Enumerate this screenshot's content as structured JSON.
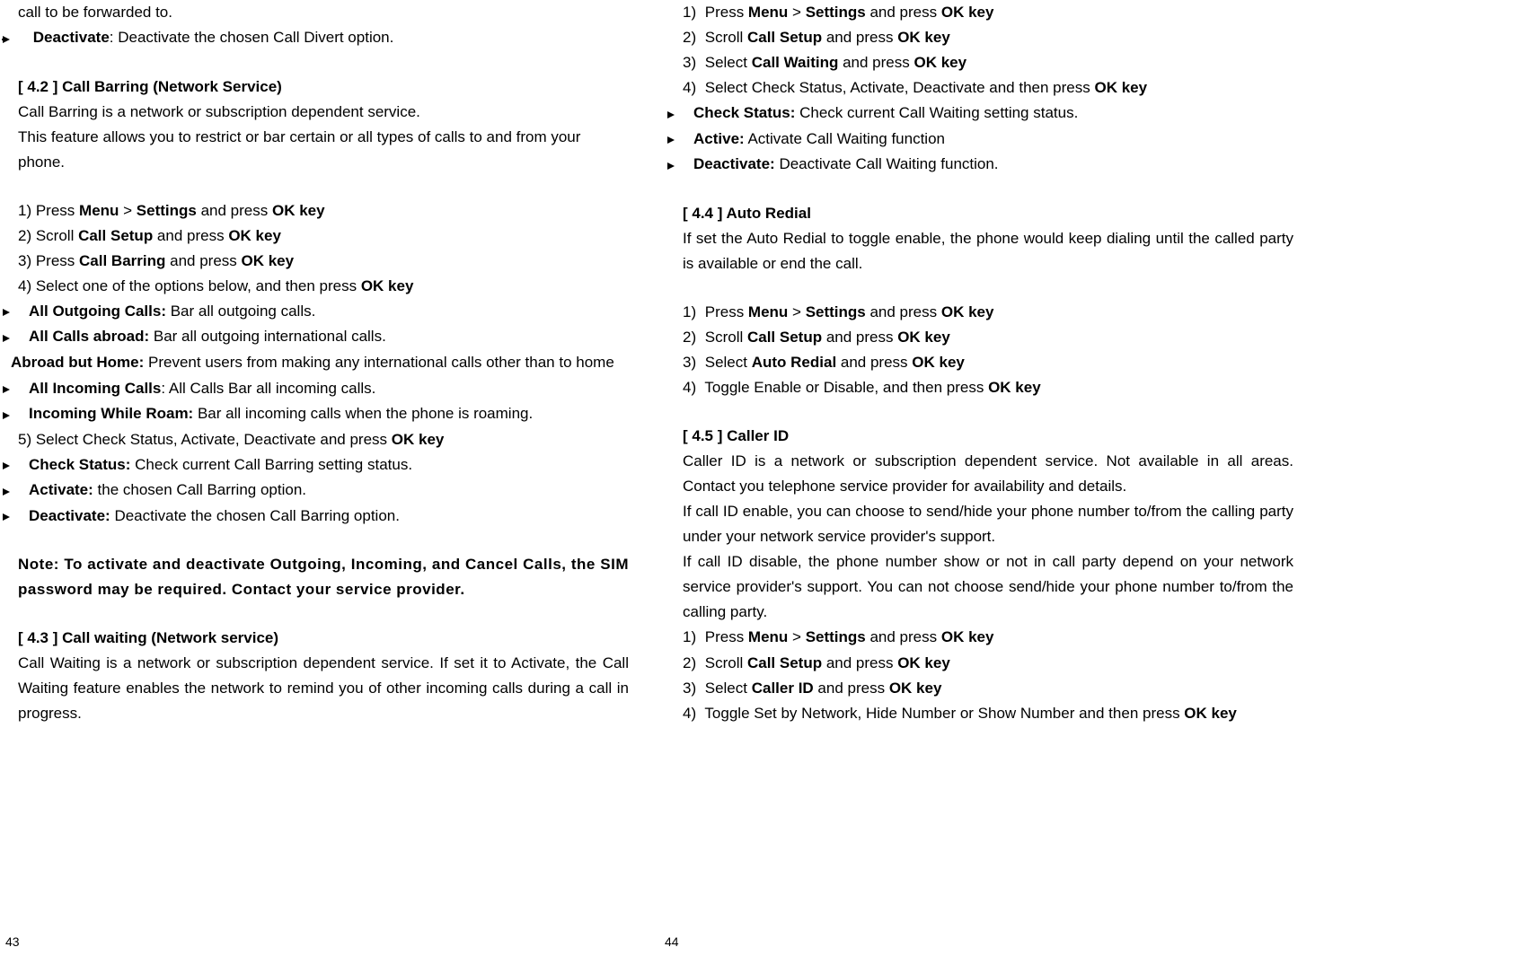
{
  "left": {
    "intro_frag": "call to be forwarded to.",
    "deactivate_label": "Deactivate",
    "deactivate_text": ": Deactivate the chosen Call Divert option.",
    "h42": "[ 4.2 ]   Call Barring (Network Service)",
    "p42a": "Call Barring is a network or subscription dependent service.",
    "p42b": "This feature allows you to restrict or bar certain or all types of calls to and from your phone.",
    "s1_pre": "1) Press ",
    "s1_b1": "Menu",
    "s1_gt": " > ",
    "s1_b2": "Settings",
    "s1_mid": " and press ",
    "s1_b3": "OK key",
    "s2_pre": "2) Scroll ",
    "s2_b1": "Call Setup",
    "s2_mid": " and press ",
    "s2_b2": "OK key",
    "s3_pre": "3) Press ",
    "s3_b1": "Call Barring",
    "s3_mid": " and press ",
    "s3_b2": "OK key",
    "s4_pre": "4) Select one of the options below, and then press ",
    "s4_b1": "OK key",
    "opt1_b": "All Outgoing Calls:",
    "opt1_t": " Bar all outgoing calls.",
    "opt2_b": "All Calls abroad:",
    "opt2_t": " Bar all outgoing international calls.",
    "opt3_b": "Abroad but Home:",
    "opt3_t": " Prevent users from making any international calls other than to home",
    "opt4_b": "All Incoming Calls",
    "opt4_t": ": All Calls Bar all incoming calls.",
    "opt5_b": "Incoming While Roam:",
    "opt5_t": " Bar all incoming calls when the phone is roaming.",
    "s5_pre": "5) Select Check Status, Activate, Deactivate and press ",
    "s5_b1": "OK key",
    "opt6_b": "Check Status:",
    "opt6_t": " Check current Call Barring setting status.",
    "opt7_b": "Activate:",
    "opt7_t": " the chosen Call Barring option.",
    "opt8_b": "Deactivate:",
    "opt8_t": " Deactivate the chosen Call Barring option.",
    "note": "Note: To activate and deactivate Outgoing, Incoming, and Cancel Calls, the SIM password may be required. Contact your service provider.",
    "h43": "[ 4.3 ]   Call waiting (Network service)",
    "p43": "Call Waiting is a network or subscription dependent service. If set it to Activate, the Call Waiting feature enables the network to remind you of other incoming calls during a call in progress.",
    "pagenum": "43"
  },
  "right": {
    "r1_n": "1)",
    "r1_pre": "Press ",
    "r1_b1": "Menu",
    "r1_gt": " > ",
    "r1_b2": "Settings",
    "r1_mid": " and press ",
    "r1_b3": "OK key",
    "r2_n": "2)",
    "r2_pre": "Scroll ",
    "r2_b1": "Call Setup",
    "r2_mid": " and press ",
    "r2_b2": "OK key",
    "r3_n": "3)",
    "r3_pre": "Select ",
    "r3_b1": "Call Waiting",
    "r3_mid": " and press ",
    "r3_b2": "OK key",
    "r4_n": "4)",
    "r4_pre": "Select Check Status, Activate, Deactivate and then press ",
    "r4_b1": "OK key",
    "ropt1_b": "Check Status:",
    "ropt1_t": " Check current Call Waiting setting status.",
    "ropt2_b": "Active:",
    "ropt2_t": " Activate Call Waiting function",
    "ropt3_b": "Deactivate:",
    "ropt3_t": " Deactivate Call Waiting function.",
    "h44": "[ 4.4 ]   Auto Redial",
    "p44": "If set the Auto Redial to toggle enable, the phone would keep dialing until the called party is available or end the call.",
    "a1_n": "1)",
    "a1_pre": "Press ",
    "a1_b1": "Menu",
    "a1_gt": " > ",
    "a1_b2": "Settings",
    "a1_mid": " and press ",
    "a1_b3": "OK key",
    "a2_n": "2)",
    "a2_pre": "Scroll ",
    "a2_b1": "Call Setup",
    "a2_mid": " and press ",
    "a2_b2": "OK key",
    "a3_n": "3)",
    "a3_pre": "Select ",
    "a3_b1": "Auto Redial",
    "a3_mid": " and press ",
    "a3_b2": "OK key",
    "a4_n": "4)",
    "a4_pre": "Toggle Enable or Disable, and then press ",
    "a4_b1": "OK key",
    "h45": "[ 4.5 ]   Caller ID",
    "p45a": "Caller ID is a network or subscription dependent service. Not available in all areas. Contact you telephone service provider for availability and details.",
    "p45b": "If call ID enable, you can choose to send/hide your phone number to/from the calling party under your network service provider's support.",
    "p45c": "If call ID disable, the phone number show or not in call party depend on your network service provider's support. You can not choose send/hide your phone number to/from the calling party.",
    "c1_n": "1)",
    "c1_pre": "Press ",
    "c1_b1": "Menu",
    "c1_gt": " > ",
    "c1_b2": "Settings",
    "c1_mid": " and press ",
    "c1_b3": "OK key",
    "c2_n": "2)",
    "c2_pre": "Scroll ",
    "c2_b1": "Call Setup",
    "c2_mid": " and press ",
    "c2_b2": "OK key",
    "c3_n": "3)",
    "c3_pre": "Select ",
    "c3_b1": "Caller ID",
    "c3_mid": " and press ",
    "c3_b2": "OK key",
    "c4_n": "4)",
    "c4_pre": "Toggle Set by Network, Hide Number or Show Number and then press ",
    "c4_b1": "OK key",
    "pagenum": "44"
  }
}
